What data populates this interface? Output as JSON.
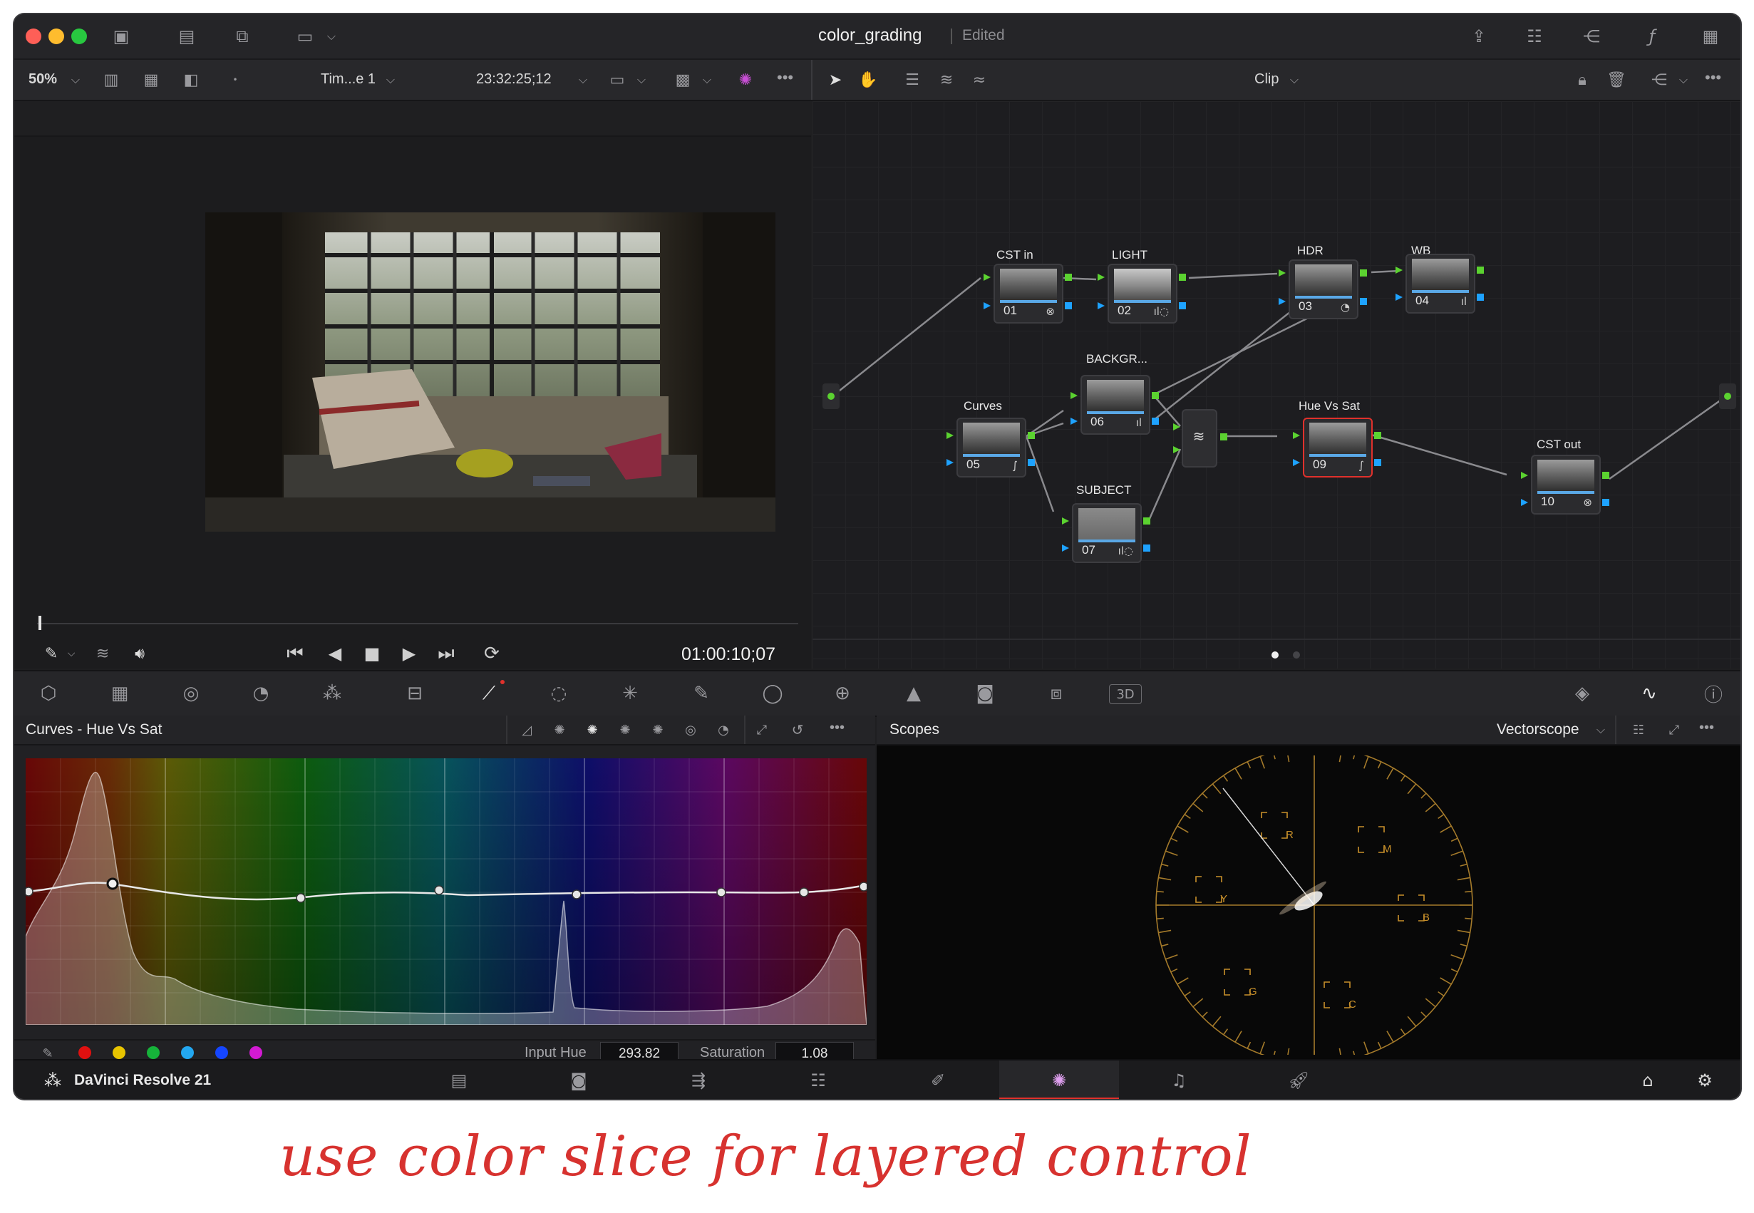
{
  "window": {
    "title": "color_grading",
    "status": "Edited"
  },
  "viewer_toolbar": {
    "zoom": "50%",
    "timeline_name": "Tim...e 1",
    "timecode": "23:32:25;12",
    "more": "•••"
  },
  "node_toolbar": {
    "mode": "Clip",
    "more": "•••"
  },
  "transport": {
    "timecode": "01:00:10;07"
  },
  "nodes": [
    {
      "label": "CST in",
      "num": "01"
    },
    {
      "label": "LIGHT",
      "num": "02"
    },
    {
      "label": "HDR",
      "num": "03"
    },
    {
      "label": "WB",
      "num": "04"
    },
    {
      "label": "Curves",
      "num": "05"
    },
    {
      "label": "BACKGR...",
      "num": "06"
    },
    {
      "label": "SUBJECT",
      "num": "07"
    },
    {
      "label": "Hue Vs Sat",
      "num": "09"
    },
    {
      "label": "CST out",
      "num": "10"
    }
  ],
  "curves_panel": {
    "title": "Curves - Hue Vs Sat",
    "more": "•••",
    "input_hue_label": "Input Hue",
    "input_hue_value": "293.82",
    "saturation_label": "Saturation",
    "saturation_value": "1.08",
    "swatch_colors": [
      "#e01010",
      "#e8c400",
      "#16b33a",
      "#23a7f0",
      "#1546ff",
      "#d31ad3"
    ]
  },
  "scopes_panel": {
    "title": "Scopes",
    "type": "Vectorscope",
    "more": "•••",
    "targets": [
      "R",
      "M",
      "Y",
      "B",
      "G",
      "C"
    ]
  },
  "pagebar": {
    "app_name": "DaVinci Resolve 21"
  },
  "annotation": {
    "text": "use color slice for layered control"
  },
  "colors": {
    "accent_red": "#e0312c",
    "pin_green": "#5bd230",
    "pin_blue": "#1ea2ff",
    "selected_node_border": "#e0312c",
    "annotation": "#d7322f"
  }
}
